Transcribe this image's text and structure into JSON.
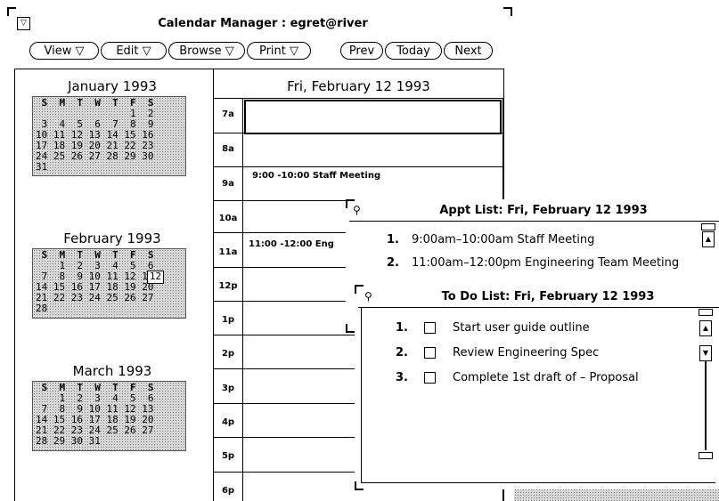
{
  "app": {
    "title": "Calendar Manager : egret@river",
    "menu_glyph": "▽"
  },
  "toolbar": {
    "view": "View ▽",
    "edit": "Edit ▽",
    "browse": "Browse ▽",
    "print": "Print ▽",
    "prev": "Prev",
    "today": "Today",
    "next": "Next"
  },
  "months": [
    {
      "title": "January 1993",
      "header": " S  M  T  W  T  F  S",
      "rows": [
        "                1  2",
        " 3  4  5  6  7  8  9",
        "10 11 12 13 14 15 16",
        "17 18 19 20 21 22 23",
        "24 25 26 27 28 29 30",
        "31"
      ]
    },
    {
      "title": "February 1993",
      "header": " S  M  T  W  T  F  S",
      "rows": [
        "    1  2  3  4  5  6",
        " 7  8  9 10 11 12 13",
        "14 15 16 17 18 19 20",
        "21 22 23 24 25 26 27",
        "28"
      ],
      "selected_day": "12"
    },
    {
      "title": "March 1993",
      "header": " S  M  T  W  T  F  S",
      "rows": [
        "    1  2  3  4  5  6",
        " 7  8  9 10 11 12 13",
        "14 15 16 17 18 19 20",
        "21 22 23 24 25 26 27",
        "28 29 30 31"
      ]
    }
  ],
  "day_view": {
    "title": "Fri, February 12 1993",
    "hours": [
      "7a",
      "8a",
      "9a",
      "10a",
      "11a",
      "12p",
      "1p",
      "2p",
      "3p",
      "4p",
      "5p",
      "6p"
    ],
    "appointments": [
      {
        "time": "9:00 -10:00",
        "text": "Staff Meeting"
      },
      {
        "time": "11:00 -12:00",
        "text": "Eng"
      }
    ]
  },
  "appt_list": {
    "title": "Appt List: Fri, February 12 1993",
    "items": [
      {
        "num": "1.",
        "text": "9:00am–10:00am  Staff Meeting"
      },
      {
        "num": "2.",
        "text": "11:00am–12:00pm  Engineering Team Meeting"
      }
    ]
  },
  "todo_list": {
    "title": "To Do List: Fri, February 12 1993",
    "items": [
      {
        "num": "1.",
        "text": "Start user guide outline"
      },
      {
        "num": "2.",
        "text": "Review Engineering Spec"
      },
      {
        "num": "3.",
        "text": "Complete 1st draft of – Proposal"
      }
    ]
  },
  "colors": {
    "background": "#ffffff",
    "stipple": "#d8d8d8",
    "border": "#000000"
  }
}
